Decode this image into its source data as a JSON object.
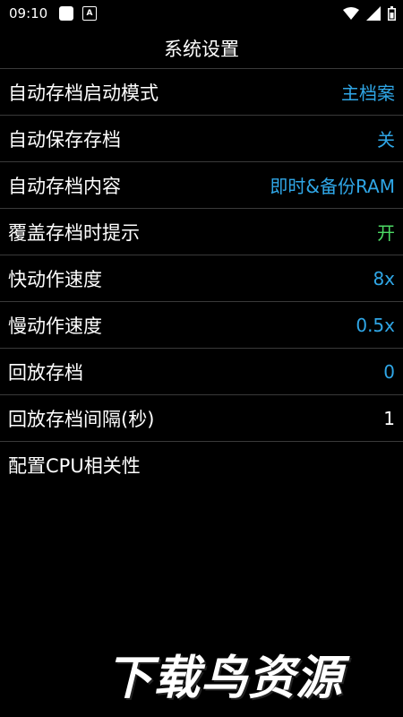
{
  "status_bar": {
    "time": "09:10"
  },
  "header": {
    "title": "系统设置"
  },
  "settings": [
    {
      "label": "自动存档启动模式",
      "value": "主档案",
      "value_color": "#2fa6e6"
    },
    {
      "label": "自动保存存档",
      "value": "关",
      "value_color": "#2fa6e6"
    },
    {
      "label": "自动存档内容",
      "value": "即时&备份RAM",
      "value_color": "#2fa6e6"
    },
    {
      "label": "覆盖存档时提示",
      "value": "开",
      "value_color": "#4cd964"
    },
    {
      "label": "快动作速度",
      "value": "8x",
      "value_color": "#2fa6e6"
    },
    {
      "label": "慢动作速度",
      "value": "0.5x",
      "value_color": "#2fa6e6"
    },
    {
      "label": "回放存档",
      "value": "0",
      "value_color": "#2fa6e6"
    },
    {
      "label": "回放存档间隔(秒)",
      "value": "1",
      "value_color": "#ffffff"
    },
    {
      "label": "配置CPU相关性",
      "value": ""
    }
  ],
  "watermark": {
    "text": "下载鸟资源"
  }
}
